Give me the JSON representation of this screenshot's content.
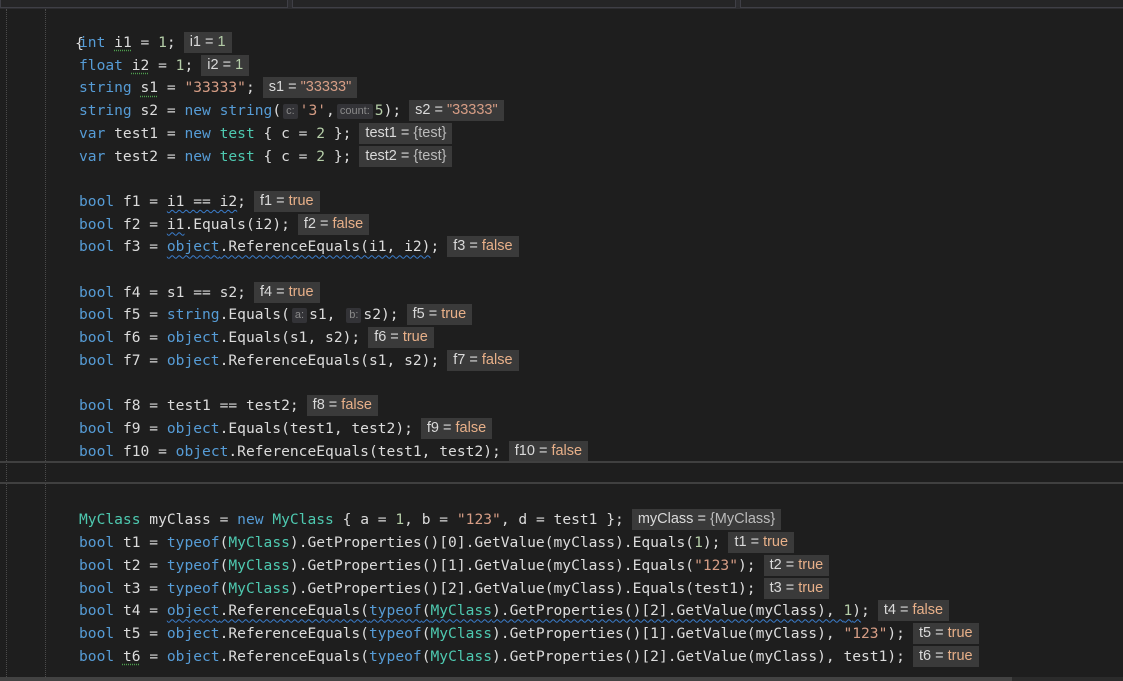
{
  "editor": {
    "open_brace": "{",
    "lines": [
      {
        "parts": [
          [
            "kw",
            "int"
          ],
          [
            "p",
            " "
          ],
          [
            "id",
            "i1"
          ],
          [
            "p",
            " = "
          ],
          [
            "num",
            "1"
          ],
          [
            "p",
            ";"
          ]
        ],
        "hint_label": "i1 = ",
        "hint_value": "1",
        "hint_kind": "num"
      },
      {
        "parts": [
          [
            "kw",
            "float"
          ],
          [
            "p",
            " "
          ],
          [
            "id",
            "i2"
          ],
          [
            "p",
            " = "
          ],
          [
            "num",
            "1"
          ],
          [
            "p",
            ";"
          ]
        ],
        "hint_label": "i2 = ",
        "hint_value": "1",
        "hint_kind": "num"
      },
      {
        "parts": [
          [
            "kw",
            "string"
          ],
          [
            "p",
            " "
          ],
          [
            "id",
            "s1"
          ],
          [
            "p",
            " = "
          ],
          [
            "str",
            "\"33333\""
          ],
          [
            "p",
            ";"
          ]
        ],
        "hint_label": "s1 = ",
        "hint_value": "\"33333\"",
        "hint_kind": "str"
      },
      {
        "parts": [
          [
            "kw",
            "string"
          ],
          [
            "p",
            " s2 = "
          ],
          [
            "kw",
            "new"
          ],
          [
            "p",
            " "
          ],
          [
            "kw",
            "string"
          ],
          [
            "p",
            "("
          ],
          [
            "hint",
            "c:"
          ],
          [
            "str",
            "'3'"
          ],
          [
            "p",
            ","
          ],
          [
            "hint",
            "count:"
          ],
          [
            "num",
            "5"
          ],
          [
            "p",
            ");"
          ]
        ],
        "hint_label": "s2 = ",
        "hint_value": "\"33333\"",
        "hint_kind": "str"
      },
      {
        "parts": [
          [
            "kw",
            "var"
          ],
          [
            "p",
            " test1 = "
          ],
          [
            "kw",
            "new"
          ],
          [
            "p",
            " "
          ],
          [
            "ty",
            "test"
          ],
          [
            "p",
            " { c = "
          ],
          [
            "num",
            "2"
          ],
          [
            "p",
            " };"
          ]
        ],
        "hint_label": "test1 = ",
        "hint_value": "{test}",
        "hint_kind": "obj"
      },
      {
        "parts": [
          [
            "kw",
            "var"
          ],
          [
            "p",
            " test2 = "
          ],
          [
            "kw",
            "new"
          ],
          [
            "p",
            " "
          ],
          [
            "ty",
            "test"
          ],
          [
            "p",
            " { c = "
          ],
          [
            "num",
            "2"
          ],
          [
            "p",
            " };"
          ]
        ],
        "hint_label": "test2 = ",
        "hint_value": "{test}",
        "hint_kind": "obj"
      },
      {
        "blank": true
      },
      {
        "parts": [
          [
            "kw",
            "bool"
          ],
          [
            "p",
            " f1 = "
          ],
          [
            "sq",
            "i1 == i2"
          ],
          [
            "p",
            ";"
          ]
        ],
        "hint_label": "f1 = ",
        "hint_value": "true",
        "hint_kind": "bool"
      },
      {
        "parts": [
          [
            "kw",
            "bool"
          ],
          [
            "p",
            " f2 = "
          ],
          [
            "sq",
            "i1"
          ],
          [
            "p",
            ".Equals(i2);"
          ]
        ],
        "hint_label": "f2 = ",
        "hint_value": "false",
        "hint_kind": "bool"
      },
      {
        "parts": [
          [
            "kw",
            "bool"
          ],
          [
            "p",
            " f3 = "
          ],
          [
            "sqkw",
            "object"
          ],
          [
            "sq",
            ".ReferenceEquals(i1, i2)"
          ],
          [
            "p",
            ";"
          ]
        ],
        "hint_label": "f3 = ",
        "hint_value": "false",
        "hint_kind": "bool"
      },
      {
        "blank": true
      },
      {
        "parts": [
          [
            "kw",
            "bool"
          ],
          [
            "p",
            " f4 = s1 == s2;"
          ]
        ],
        "hint_label": "f4 = ",
        "hint_value": "true",
        "hint_kind": "bool"
      },
      {
        "parts": [
          [
            "kw",
            "bool"
          ],
          [
            "p",
            " f5 = "
          ],
          [
            "kw",
            "string"
          ],
          [
            "p",
            ".Equals("
          ],
          [
            "hint",
            "a:"
          ],
          [
            "p",
            "s1, "
          ],
          [
            "hint",
            "b:"
          ],
          [
            "p",
            "s2);"
          ]
        ],
        "hint_label": "f5 = ",
        "hint_value": "true",
        "hint_kind": "bool"
      },
      {
        "parts": [
          [
            "kw",
            "bool"
          ],
          [
            "p",
            " f6 = "
          ],
          [
            "kw",
            "object"
          ],
          [
            "p",
            ".Equals(s1, s2);"
          ]
        ],
        "hint_label": "f6 = ",
        "hint_value": "true",
        "hint_kind": "bool"
      },
      {
        "parts": [
          [
            "kw",
            "bool"
          ],
          [
            "p",
            " f7 = "
          ],
          [
            "kw",
            "object"
          ],
          [
            "p",
            ".ReferenceEquals(s1, s2);"
          ]
        ],
        "hint_label": "f7 = ",
        "hint_value": "false",
        "hint_kind": "bool"
      },
      {
        "blank": true
      },
      {
        "parts": [
          [
            "kw",
            "bool"
          ],
          [
            "p",
            " f8 = test1 == test2;"
          ]
        ],
        "hint_label": "f8 = ",
        "hint_value": "false",
        "hint_kind": "bool"
      },
      {
        "parts": [
          [
            "kw",
            "bool"
          ],
          [
            "p",
            " f9 = "
          ],
          [
            "kw",
            "object"
          ],
          [
            "p",
            ".Equals(test1, test2);"
          ]
        ],
        "hint_label": "f9 = ",
        "hint_value": "false",
        "hint_kind": "bool"
      },
      {
        "parts": [
          [
            "kw",
            "bool"
          ],
          [
            "p",
            " f10 = "
          ],
          [
            "kw",
            "object"
          ],
          [
            "p",
            ".ReferenceEquals(test1, test2);"
          ]
        ],
        "hint_label": "f10 = ",
        "hint_value": "false",
        "hint_kind": "bool"
      }
    ],
    "lines2": [
      {
        "parts": [
          [
            "ty",
            "MyClass"
          ],
          [
            "p",
            " myClass = "
          ],
          [
            "kw",
            "new"
          ],
          [
            "p",
            " "
          ],
          [
            "ty",
            "MyClass"
          ],
          [
            "p",
            " { a = "
          ],
          [
            "num",
            "1"
          ],
          [
            "p",
            ", b = "
          ],
          [
            "str",
            "\"123\""
          ],
          [
            "p",
            ", d = test1 };"
          ]
        ],
        "hint_label": "myClass = ",
        "hint_value": "{MyClass}",
        "hint_kind": "obj"
      },
      {
        "parts": [
          [
            "kw",
            "bool"
          ],
          [
            "p",
            " t1 = "
          ],
          [
            "kw",
            "typeof"
          ],
          [
            "p",
            "("
          ],
          [
            "ty",
            "MyClass"
          ],
          [
            "p",
            ").GetProperties()[0].GetValue(myClass).Equals("
          ],
          [
            "num",
            "1"
          ],
          [
            "p",
            ");"
          ]
        ],
        "hint_label": "t1 = ",
        "hint_value": "true",
        "hint_kind": "bool"
      },
      {
        "parts": [
          [
            "kw",
            "bool"
          ],
          [
            "p",
            " t2 = "
          ],
          [
            "kw",
            "typeof"
          ],
          [
            "p",
            "("
          ],
          [
            "ty",
            "MyClass"
          ],
          [
            "p",
            ").GetProperties()[1].GetValue(myClass).Equals("
          ],
          [
            "str",
            "\"123\""
          ],
          [
            "p",
            ");"
          ]
        ],
        "hint_label": "t2 = ",
        "hint_value": "true",
        "hint_kind": "bool"
      },
      {
        "parts": [
          [
            "kw",
            "bool"
          ],
          [
            "p",
            " t3 = "
          ],
          [
            "kw",
            "typeof"
          ],
          [
            "p",
            "("
          ],
          [
            "ty",
            "MyClass"
          ],
          [
            "p",
            ").GetProperties()[2].GetValue(myClass).Equals(test1);"
          ]
        ],
        "hint_label": "t3 = ",
        "hint_value": "true",
        "hint_kind": "bool"
      },
      {
        "parts": [
          [
            "kw",
            "bool"
          ],
          [
            "p",
            " t4 = "
          ],
          [
            "sqkw",
            "object"
          ],
          [
            "sq",
            ".ReferenceEquals("
          ],
          [
            "sqkw",
            "typeof"
          ],
          [
            "sq",
            "("
          ],
          [
            "sqty",
            "MyClass"
          ],
          [
            "sq",
            ").GetProperties()[2].GetValue(myClass), "
          ],
          [
            "sqnum",
            "1"
          ],
          [
            "sq",
            ")"
          ],
          [
            "p",
            ";"
          ]
        ],
        "hint_label": "t4 = ",
        "hint_value": "false",
        "hint_kind": "bool"
      },
      {
        "parts": [
          [
            "kw",
            "bool"
          ],
          [
            "p",
            " t5 = "
          ],
          [
            "kw",
            "object"
          ],
          [
            "p",
            ".ReferenceEquals("
          ],
          [
            "kw",
            "typeof"
          ],
          [
            "p",
            "("
          ],
          [
            "ty",
            "MyClass"
          ],
          [
            "p",
            ").GetProperties()[1].GetValue(myClass), "
          ],
          [
            "str",
            "\"123\""
          ],
          [
            "p",
            ");"
          ]
        ],
        "hint_label": "t5 = ",
        "hint_value": "true",
        "hint_kind": "bool"
      },
      {
        "parts": [
          [
            "kw",
            "bool"
          ],
          [
            "p",
            " "
          ],
          [
            "dt",
            "t6"
          ],
          [
            "p",
            " = "
          ],
          [
            "kw",
            "object"
          ],
          [
            "p",
            ".ReferenceEquals("
          ],
          [
            "kw",
            "typeof"
          ],
          [
            "p",
            "("
          ],
          [
            "ty",
            "MyClass"
          ],
          [
            "p",
            ").GetProperties()[2].GetValue(myClass), test1);"
          ]
        ],
        "hint_label": "t6 = ",
        "hint_value": "true",
        "hint_kind": "bool"
      }
    ]
  },
  "colors": {
    "background": "#1e1e1e",
    "keyword": "#569cd6",
    "type": "#4ec9b0",
    "string": "#d69d85",
    "number": "#b5cea8",
    "bool_value": "#e8b089",
    "squiggle": "#3a7dcc"
  }
}
